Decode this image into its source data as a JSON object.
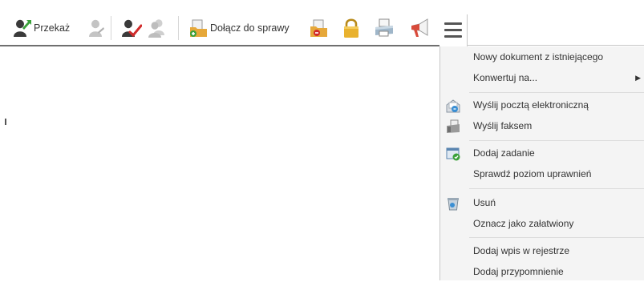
{
  "toolbar": {
    "przekaz_label": "Przekaż",
    "dolacz_label": "Dołącz do sprawy",
    "icons": [
      "forward-user-icon",
      "user-disabled-icon",
      "user-reject-icon",
      "users-disabled-icon",
      "attach-folder-icon",
      "folder-remove-icon",
      "lock-icon",
      "print-icon",
      "announce-icon",
      "hamburger-menu-icon"
    ]
  },
  "menu": {
    "items": [
      {
        "label": "Nowy dokument z istniejącego",
        "icon": "",
        "submenu": false
      },
      {
        "label": "Konwertuj na...",
        "icon": "",
        "submenu": true
      },
      {
        "label": "Wyślij pocztą elektroniczną",
        "icon": "email-send-icon",
        "submenu": false
      },
      {
        "label": "Wyślij faksem",
        "icon": "fax-icon",
        "submenu": false
      },
      {
        "label": "Dodaj zadanie",
        "icon": "task-add-icon",
        "submenu": false
      },
      {
        "label": "Sprawdź poziom uprawnień",
        "icon": "",
        "submenu": false
      },
      {
        "label": "Usuń",
        "icon": "trash-icon",
        "submenu": false
      },
      {
        "label": "Oznacz jako załatwiony",
        "icon": "",
        "submenu": false
      },
      {
        "label": "Dodaj wpis w rejestrze",
        "icon": "",
        "submenu": false
      },
      {
        "label": "Dodaj przypomnienie",
        "icon": "",
        "submenu": false
      }
    ],
    "submenu_arrow": "▶"
  },
  "colors": {
    "accent_green": "#3aa13a",
    "accent_red": "#d12a2a",
    "separator": "#6f6f6f",
    "menu_bg": "#f4f4f4"
  }
}
